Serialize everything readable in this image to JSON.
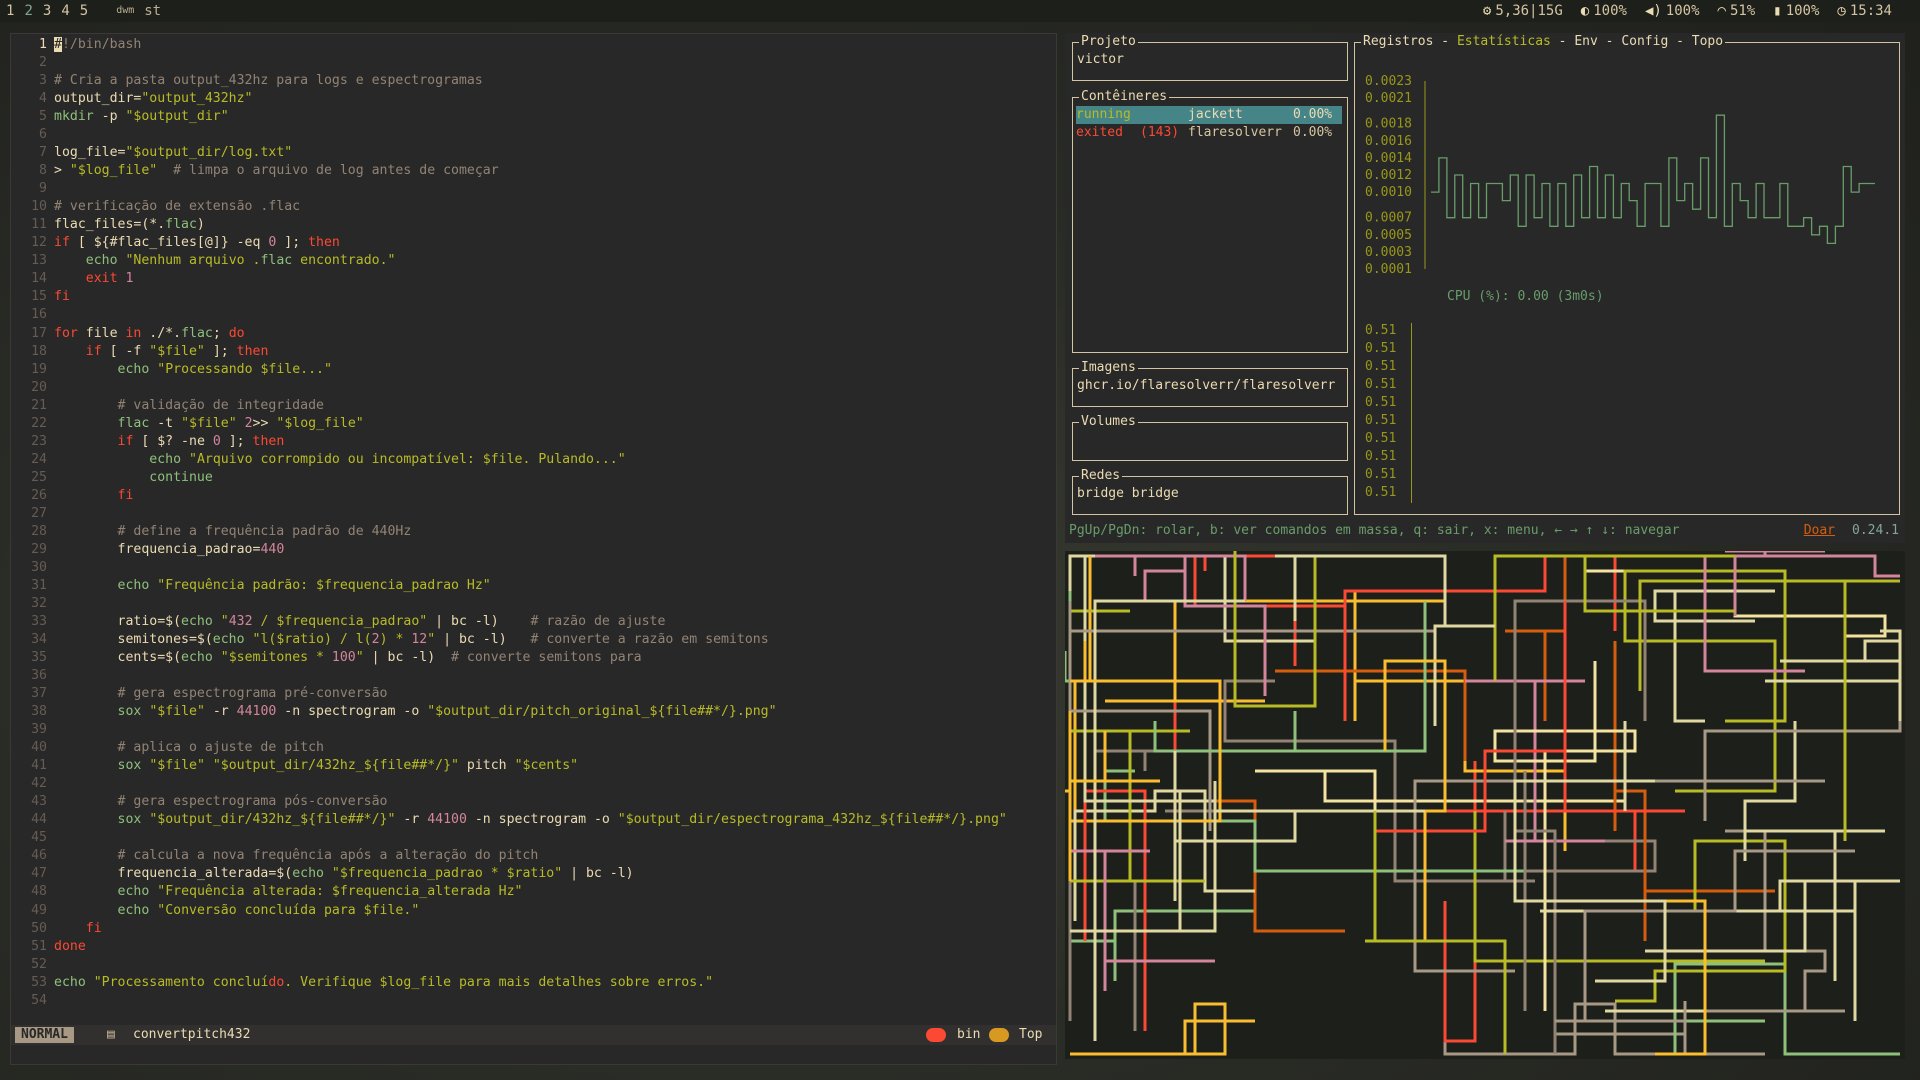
{
  "topbar": {
    "workspaces": [
      {
        "label": "1",
        "active": false
      },
      {
        "label": "2",
        "active": true
      },
      {
        "label": "3",
        "active": false
      },
      {
        "label": "4",
        "active": false
      },
      {
        "label": "5",
        "active": false
      }
    ],
    "layout_indicator": "dwm",
    "window_title": "st",
    "status": {
      "memory": "5,36|15G",
      "brightness": "100%",
      "volume": "100%",
      "wifi": "51%",
      "battery": "100%",
      "clock": "15:34"
    },
    "icons": {
      "memory": "cpu-icon",
      "brightness": "brightness-icon",
      "volume": "volume-icon",
      "wifi": "wifi-icon",
      "battery": "battery-icon",
      "clock": "clock-icon"
    }
  },
  "vim": {
    "lines": [
      {
        "n": "1",
        "t": "#!/bin/bash"
      },
      {
        "n": "2",
        "t": ""
      },
      {
        "n": "3",
        "t": "# Cria a pasta output_432hz para logs e espectrogramas"
      },
      {
        "n": "4",
        "t": "output_dir=\"output_432hz\""
      },
      {
        "n": "5",
        "t": "mkdir -p \"$output_dir\""
      },
      {
        "n": "6",
        "t": ""
      },
      {
        "n": "7",
        "t": "log_file=\"$output_dir/log.txt\""
      },
      {
        "n": "8",
        "t": "> \"$log_file\"  # limpa o arquivo de log antes de começar"
      },
      {
        "n": "9",
        "t": ""
      },
      {
        "n": "10",
        "t": "# verificação de extensão .flac"
      },
      {
        "n": "11",
        "t": "flac_files=(*.flac)"
      },
      {
        "n": "12",
        "t": "if [ ${#flac_files[@]} -eq 0 ]; then"
      },
      {
        "n": "13",
        "t": "    echo \"Nenhum arquivo .flac encontrado.\""
      },
      {
        "n": "14",
        "t": "    exit 1"
      },
      {
        "n": "15",
        "t": "fi"
      },
      {
        "n": "16",
        "t": ""
      },
      {
        "n": "17",
        "t": "for file in ./*.flac; do"
      },
      {
        "n": "18",
        "t": "    if [ -f \"$file\" ]; then"
      },
      {
        "n": "19",
        "t": "        echo \"Processando $file...\""
      },
      {
        "n": "20",
        "t": ""
      },
      {
        "n": "21",
        "t": "        # validação de integridade"
      },
      {
        "n": "22",
        "t": "        flac -t \"$file\" 2>> \"$log_file\""
      },
      {
        "n": "23",
        "t": "        if [ $? -ne 0 ]; then"
      },
      {
        "n": "24",
        "t": "            echo \"Arquivo corrompido ou incompatível: $file. Pulando...\""
      },
      {
        "n": "25",
        "t": "            continue"
      },
      {
        "n": "26",
        "t": "        fi"
      },
      {
        "n": "27",
        "t": ""
      },
      {
        "n": "28",
        "t": "        # define a frequência padrão de 440Hz"
      },
      {
        "n": "29",
        "t": "        frequencia_padrao=440"
      },
      {
        "n": "30",
        "t": ""
      },
      {
        "n": "31",
        "t": "        echo \"Frequência padrão: $frequencia_padrao Hz\""
      },
      {
        "n": "32",
        "t": ""
      },
      {
        "n": "33",
        "t": "        ratio=$(echo \"432 / $frequencia_padrao\" | bc -l)    # razão de ajuste"
      },
      {
        "n": "34",
        "t": "        semitones=$(echo \"l($ratio) / l(2) * 12\" | bc -l)   # converte a razão em semitons"
      },
      {
        "n": "35",
        "t": "        cents=$(echo \"$semitones * 100\" | bc -l)  # converte semitons para"
      },
      {
        "n": "36",
        "t": ""
      },
      {
        "n": "37",
        "t": "        # gera espectrograma pré-conversão"
      },
      {
        "n": "38",
        "t": "        sox \"$file\" -r 44100 -n spectrogram -o \"$output_dir/pitch_original_${file##*/}.png\""
      },
      {
        "n": "39",
        "t": ""
      },
      {
        "n": "40",
        "t": "        # aplica o ajuste de pitch"
      },
      {
        "n": "41",
        "t": "        sox \"$file\" \"$output_dir/432hz_${file##*/}\" pitch \"$cents\""
      },
      {
        "n": "42",
        "t": ""
      },
      {
        "n": "43",
        "t": "        # gera espectrograma pós-conversão"
      },
      {
        "n": "44",
        "t": "        sox \"$output_dir/432hz_${file##*/}\" -r 44100 -n spectrogram -o \"$output_dir/espectrograma_432hz_${file##*/}.png\""
      },
      {
        "n": "45",
        "t": ""
      },
      {
        "n": "46",
        "t": "        # calcula a nova frequência após a alteração do pitch"
      },
      {
        "n": "47",
        "t": "        frequencia_alterada=$(echo \"$frequencia_padrao * $ratio\" | bc -l)"
      },
      {
        "n": "48",
        "t": "        echo \"Frequência alterada: $frequencia_alterada Hz\""
      },
      {
        "n": "49",
        "t": "        echo \"Conversão concluída para $file.\""
      },
      {
        "n": "50",
        "t": "    fi"
      },
      {
        "n": "51",
        "t": "done"
      },
      {
        "n": "52",
        "t": ""
      },
      {
        "n": "53",
        "t": "echo \"Processamento concluído. Verifique $log_file para mais detalhes sobre erros.\""
      },
      {
        "n": "54",
        "t": ""
      }
    ],
    "statusline": {
      "mode": "NORMAL",
      "filename": "convertpitch432",
      "filetype": "bin",
      "position": "Top"
    }
  },
  "lazydocker": {
    "project": {
      "title": "Projeto",
      "value": "victor"
    },
    "containers": {
      "title": "Contêineres",
      "rows": [
        {
          "status": "running",
          "name": "jackett",
          "cpu": "0.00%",
          "selected": true
        },
        {
          "status": "exited",
          "code": "(143)",
          "name": "flaresolverr",
          "cpu": "0.00%",
          "selected": false
        }
      ]
    },
    "images": {
      "title": "Imagens",
      "value": "ghcr.io/flaresolverr/flaresolverr"
    },
    "volumes": {
      "title": "Volumes",
      "value": ""
    },
    "networks": {
      "title": "Redes",
      "value": "bridge bridge"
    },
    "tabs": [
      {
        "label": "Registros",
        "active": false
      },
      {
        "label": "Estatísticas",
        "active": true
      },
      {
        "label": "Env",
        "active": false
      },
      {
        "label": "Config",
        "active": false
      },
      {
        "label": "Topo",
        "active": false
      }
    ],
    "tab_separator": " - ",
    "cpu_caption": "CPU (%): 0.00 (3m0s)",
    "mem_labels": [
      "0.51",
      "0.51",
      "0.51",
      "0.51",
      "0.51",
      "0.51",
      "0.51",
      "0.51",
      "0.51",
      "0.51"
    ],
    "footer": "PgUp/PgDn: rolar, b: ver comandos em massa, q: sair, x: menu, ← → ↑ ↓: navegar",
    "donate": "Doar",
    "version": "0.24.1"
  },
  "chart_data": {
    "type": "line",
    "title": "",
    "xlabel": "",
    "ylabel": "",
    "ylim": [
      0.0001,
      0.0023
    ],
    "y_ticks": [
      "0.0023",
      "0.0021",
      "0.0018",
      "0.0016",
      "0.0014",
      "0.0012",
      "0.0010",
      "0.0007",
      "0.0005",
      "0.0003",
      "0.0001"
    ],
    "series": [
      {
        "values": [
          0.001,
          0.0014,
          0.0007,
          0.0012,
          0.0007,
          0.0011,
          0.0007,
          0.0011,
          0.0011,
          0.0009,
          0.0012,
          0.0006,
          0.0012,
          0.0007,
          0.0011,
          0.0006,
          0.0011,
          0.0006,
          0.0012,
          0.0007,
          0.0013,
          0.0007,
          0.0012,
          0.0007,
          0.0011,
          0.0009,
          0.0006,
          0.0011,
          0.0011,
          0.0006,
          0.0014,
          0.0009,
          0.0011,
          0.0008,
          0.0014,
          0.0007,
          0.0019,
          0.0006,
          0.0011,
          0.0009,
          0.0007,
          0.0011,
          0.0007,
          0.0007,
          0.0011,
          0.0006,
          0.0006,
          0.0007,
          0.0005,
          0.0006,
          0.0004,
          0.0006,
          0.0013,
          0.001,
          0.0011,
          0.0011
        ]
      }
    ],
    "colors": {
      "line": "#689d6a",
      "axis": "#98971a"
    }
  }
}
